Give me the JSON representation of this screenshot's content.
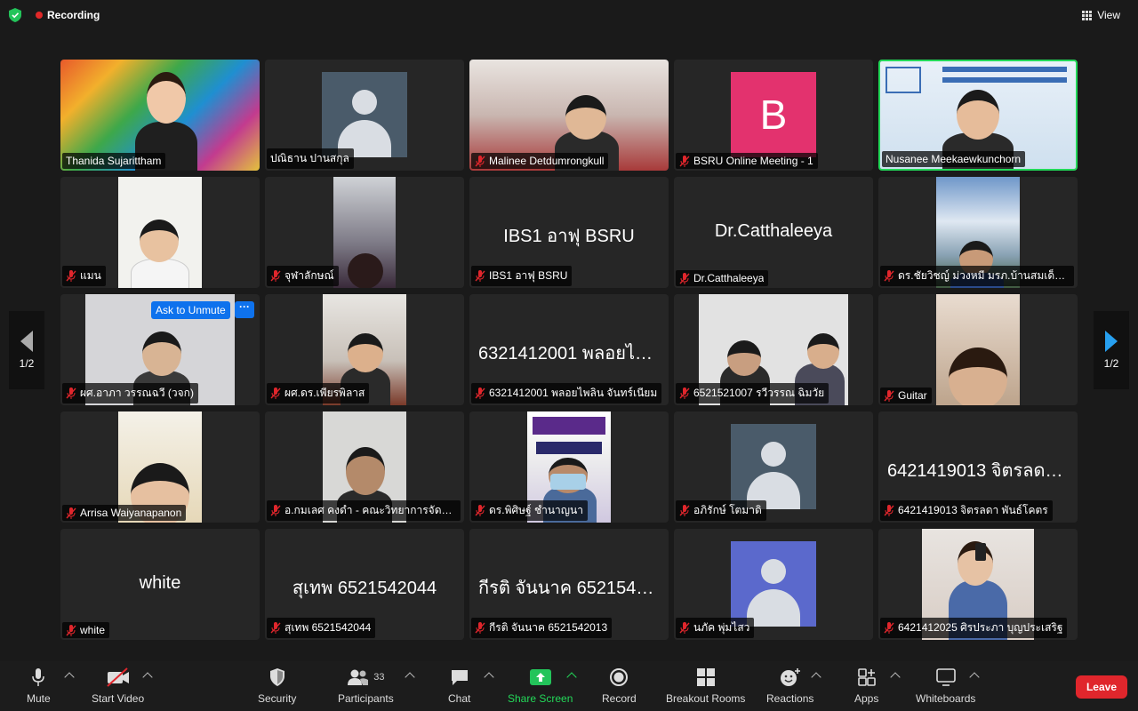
{
  "topbar": {
    "recording_label": "Recording",
    "view_label": "View"
  },
  "pagination": {
    "left_label": "1/2",
    "right_label": "1/2"
  },
  "overlay": {
    "ask_unmute_label": "Ask to Unmute",
    "more_label": "···"
  },
  "tiles": [
    {
      "name": "Thanida Sujarittham",
      "muted": false,
      "kind": "video"
    },
    {
      "name": "ปณิธาน ปานสกุล",
      "muted": false,
      "kind": "avatar"
    },
    {
      "name": "Malinee Detdumrongkull",
      "muted": true,
      "kind": "video"
    },
    {
      "name": "BSRU Online Meeting - 1",
      "muted": true,
      "kind": "letter",
      "letter": "B"
    },
    {
      "name": "Nusanee Meekaewkunchorn",
      "muted": false,
      "kind": "video",
      "active": true
    },
    {
      "name": "แมน",
      "muted": true,
      "kind": "video"
    },
    {
      "name": "จุฬาลักษณ์",
      "muted": true,
      "kind": "video"
    },
    {
      "name": "IBS1 อาฟุ BSRU",
      "muted": true,
      "kind": "text",
      "big": "IBS1 อาฟุ BSRU"
    },
    {
      "name": "Dr.Catthaleeya",
      "muted": true,
      "kind": "text",
      "big": "Dr.Catthaleeya"
    },
    {
      "name": "ดร.ชัยวิชญ์ ม่วงหมี มรภ.บ้านสมเด็จเจ้าพระยา",
      "muted": true,
      "kind": "video"
    },
    {
      "name": "ผศ.อาภา วรรณฉวี (วจก)",
      "muted": true,
      "kind": "video"
    },
    {
      "name": "ผศ.ดร.เพียรพิลาส",
      "muted": true,
      "kind": "video"
    },
    {
      "name": "6321412001 พลอยไพลิน จันทร์เนียม",
      "muted": true,
      "kind": "text",
      "big": "6321412001 พลอยไพลิน"
    },
    {
      "name": "6521521007 รวีวรรณ ฉิมวัย",
      "muted": true,
      "kind": "video"
    },
    {
      "name": "Guitar",
      "muted": true,
      "kind": "video"
    },
    {
      "name": "Arrisa Waiyanapanon",
      "muted": true,
      "kind": "video"
    },
    {
      "name": "อ.กมเลศ คงดำ - คณะวิทยาการจัดการ",
      "muted": true,
      "kind": "video"
    },
    {
      "name": "ดร.พิศิษฐ์ ชำนาญนา",
      "muted": true,
      "kind": "video"
    },
    {
      "name": "อภิรักษ์ โตมาดิ",
      "muted": true,
      "kind": "avatar"
    },
    {
      "name": "6421419013 จิตรลดา พันธ์โคตร",
      "muted": true,
      "kind": "text",
      "big": "6421419013 จิตรลดา พันธ์โคตร"
    },
    {
      "name": "white",
      "muted": true,
      "kind": "text",
      "big": "white"
    },
    {
      "name": "สุเทพ 6521542044",
      "muted": true,
      "kind": "text",
      "big": "สุเทพ 6521542044"
    },
    {
      "name": "กีรติ จันนาค 6521542013",
      "muted": true,
      "kind": "text",
      "big": "กีรติ จันนาค 6521542013"
    },
    {
      "name": "นภัค พุ่มไสว",
      "muted": true,
      "kind": "avatar-blue"
    },
    {
      "name": "6421412025 ศิรประภา บุญประเสริฐ",
      "muted": true,
      "kind": "video"
    }
  ],
  "toolbar": {
    "mute": "Mute",
    "start_video": "Start Video",
    "security": "Security",
    "participants": "Participants",
    "participants_count": "33",
    "chat": "Chat",
    "share_screen": "Share Screen",
    "record": "Record",
    "breakout": "Breakout Rooms",
    "reactions": "Reactions",
    "apps": "Apps",
    "whiteboards": "Whiteboards",
    "leave": "Leave"
  },
  "colors": {
    "active_speaker": "#23d959",
    "leave": "#e0262c",
    "share": "#23c45a",
    "accent": "#0e72ed"
  }
}
